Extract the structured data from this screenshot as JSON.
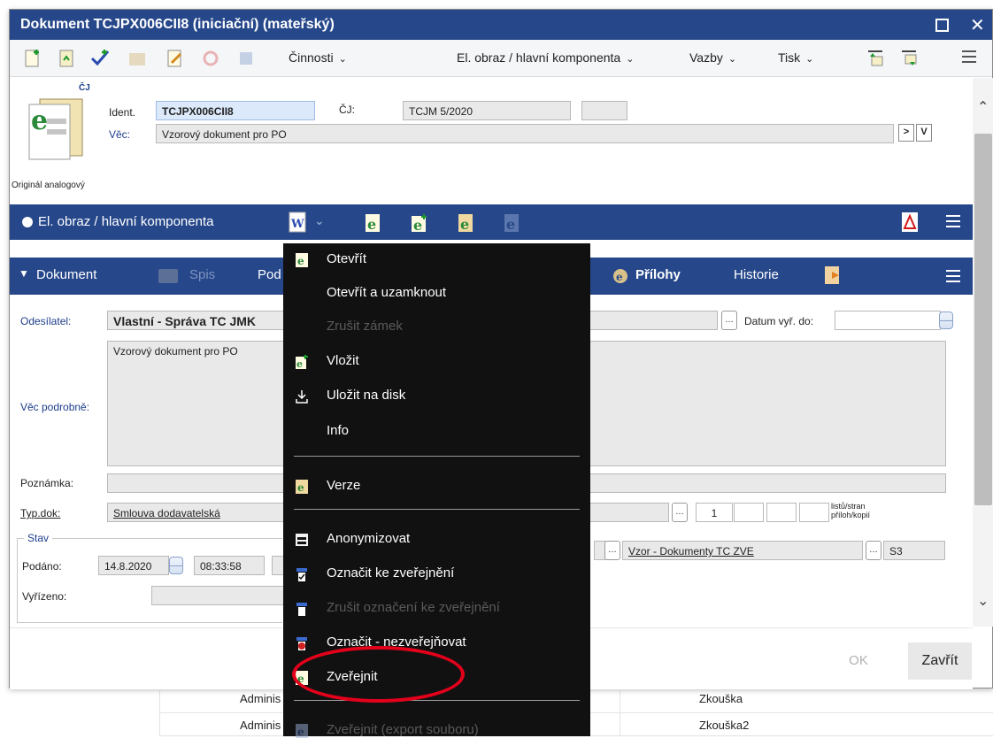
{
  "window": {
    "title": "Dokument TCJPX006CII8 (iniciační) (mateřský)"
  },
  "toolbar": {
    "menus": [
      {
        "label": "Činnosti"
      },
      {
        "label": "El. obraz / hlavní komponenta"
      },
      {
        "label": "Vazby"
      },
      {
        "label": "Tisk"
      }
    ]
  },
  "header": {
    "cj_badge": "ČJ",
    "original_label": "Originál analogový",
    "ident_label": "Ident.",
    "ident_value": "TCJPX006CII8",
    "cj_label": "ČJ:",
    "cj_value": "TCJM 5/2020",
    "cj_extra": "",
    "vec_label": "Věc:",
    "vec_value": "Vzorový dokument pro PO",
    "btn_next": ">",
    "btn_v": "V"
  },
  "el_obraz_bar": {
    "label": "El. obraz / hlavní komponenta"
  },
  "dokument_bar": {
    "tabs": [
      {
        "label": "Dokument"
      },
      {
        "label": "Spis"
      },
      {
        "label": "Pod"
      },
      {
        "label": "Přílohy"
      },
      {
        "label": "Historie"
      }
    ]
  },
  "form": {
    "odesilatel_label": "Odesílatel:",
    "odesilatel_value": "Vlastní - Správa TC JMK",
    "datum_vyr_label": "Datum vyř. do:",
    "vec_podrobne_label": "Věc podrobně:",
    "vec_podrobne_value": "Vzorový dokument pro PO",
    "poznamka_label": "Poznámka:",
    "typ_dok_label": "Typ.dok:",
    "typ_dok_value": "Smlouva dodavatelská",
    "count_value": "1",
    "counts_caption": "listů/stran příloh/kopií",
    "stav_label": "Stav",
    "podano_label": "Podáno:",
    "podano_date": "14.8.2020",
    "podano_time": "08:33:58",
    "vyrizeno_label": "Vyřízeno:",
    "vzor_value": "Vzor - Dokumenty TC ZVE",
    "s3_value": "S3"
  },
  "dropdown": {
    "items": [
      {
        "label": "Otevřít",
        "icon": "e-doc-icon",
        "disabled": false
      },
      {
        "label": "Otevřít a uzamknout",
        "icon": "",
        "disabled": false
      },
      {
        "label": "Zrušit zámek",
        "icon": "",
        "disabled": true
      },
      {
        "label": "Vložit",
        "icon": "insert-doc-icon",
        "disabled": false
      },
      {
        "label": "Uložit na disk",
        "icon": "download-icon",
        "disabled": false
      },
      {
        "label": "Info",
        "icon": "",
        "disabled": false
      },
      {
        "label": "Verze",
        "icon": "versions-icon",
        "disabled": false
      },
      {
        "label": "Anonymizovat",
        "icon": "anonymize-icon",
        "disabled": false
      },
      {
        "label": "Označit ke zveřejnění",
        "icon": "mark-publish-icon",
        "disabled": false
      },
      {
        "label": "Zrušit označení ke zveřejnění",
        "icon": "unmark-publish-icon",
        "disabled": true
      },
      {
        "label": "Označit - nezveřejňovat",
        "icon": "mark-nopublish-icon",
        "disabled": false
      },
      {
        "label": "Zveřejnit",
        "icon": "publish-icon",
        "disabled": false
      },
      {
        "label": "Zveřejnit (export souboru)",
        "icon": "publish-export-icon",
        "disabled": true
      }
    ]
  },
  "footer": {
    "ok_label": "OK",
    "close_label": "Zavřít"
  },
  "background_table": {
    "rows": [
      {
        "col1": "Adminis",
        "col2": "Zkouška"
      },
      {
        "col1": "Adminis",
        "col2": "Zkouška2"
      }
    ]
  },
  "colors": {
    "primary_bar": "#26478a",
    "menu_bg": "#111111",
    "highlight": "#e3001b"
  }
}
